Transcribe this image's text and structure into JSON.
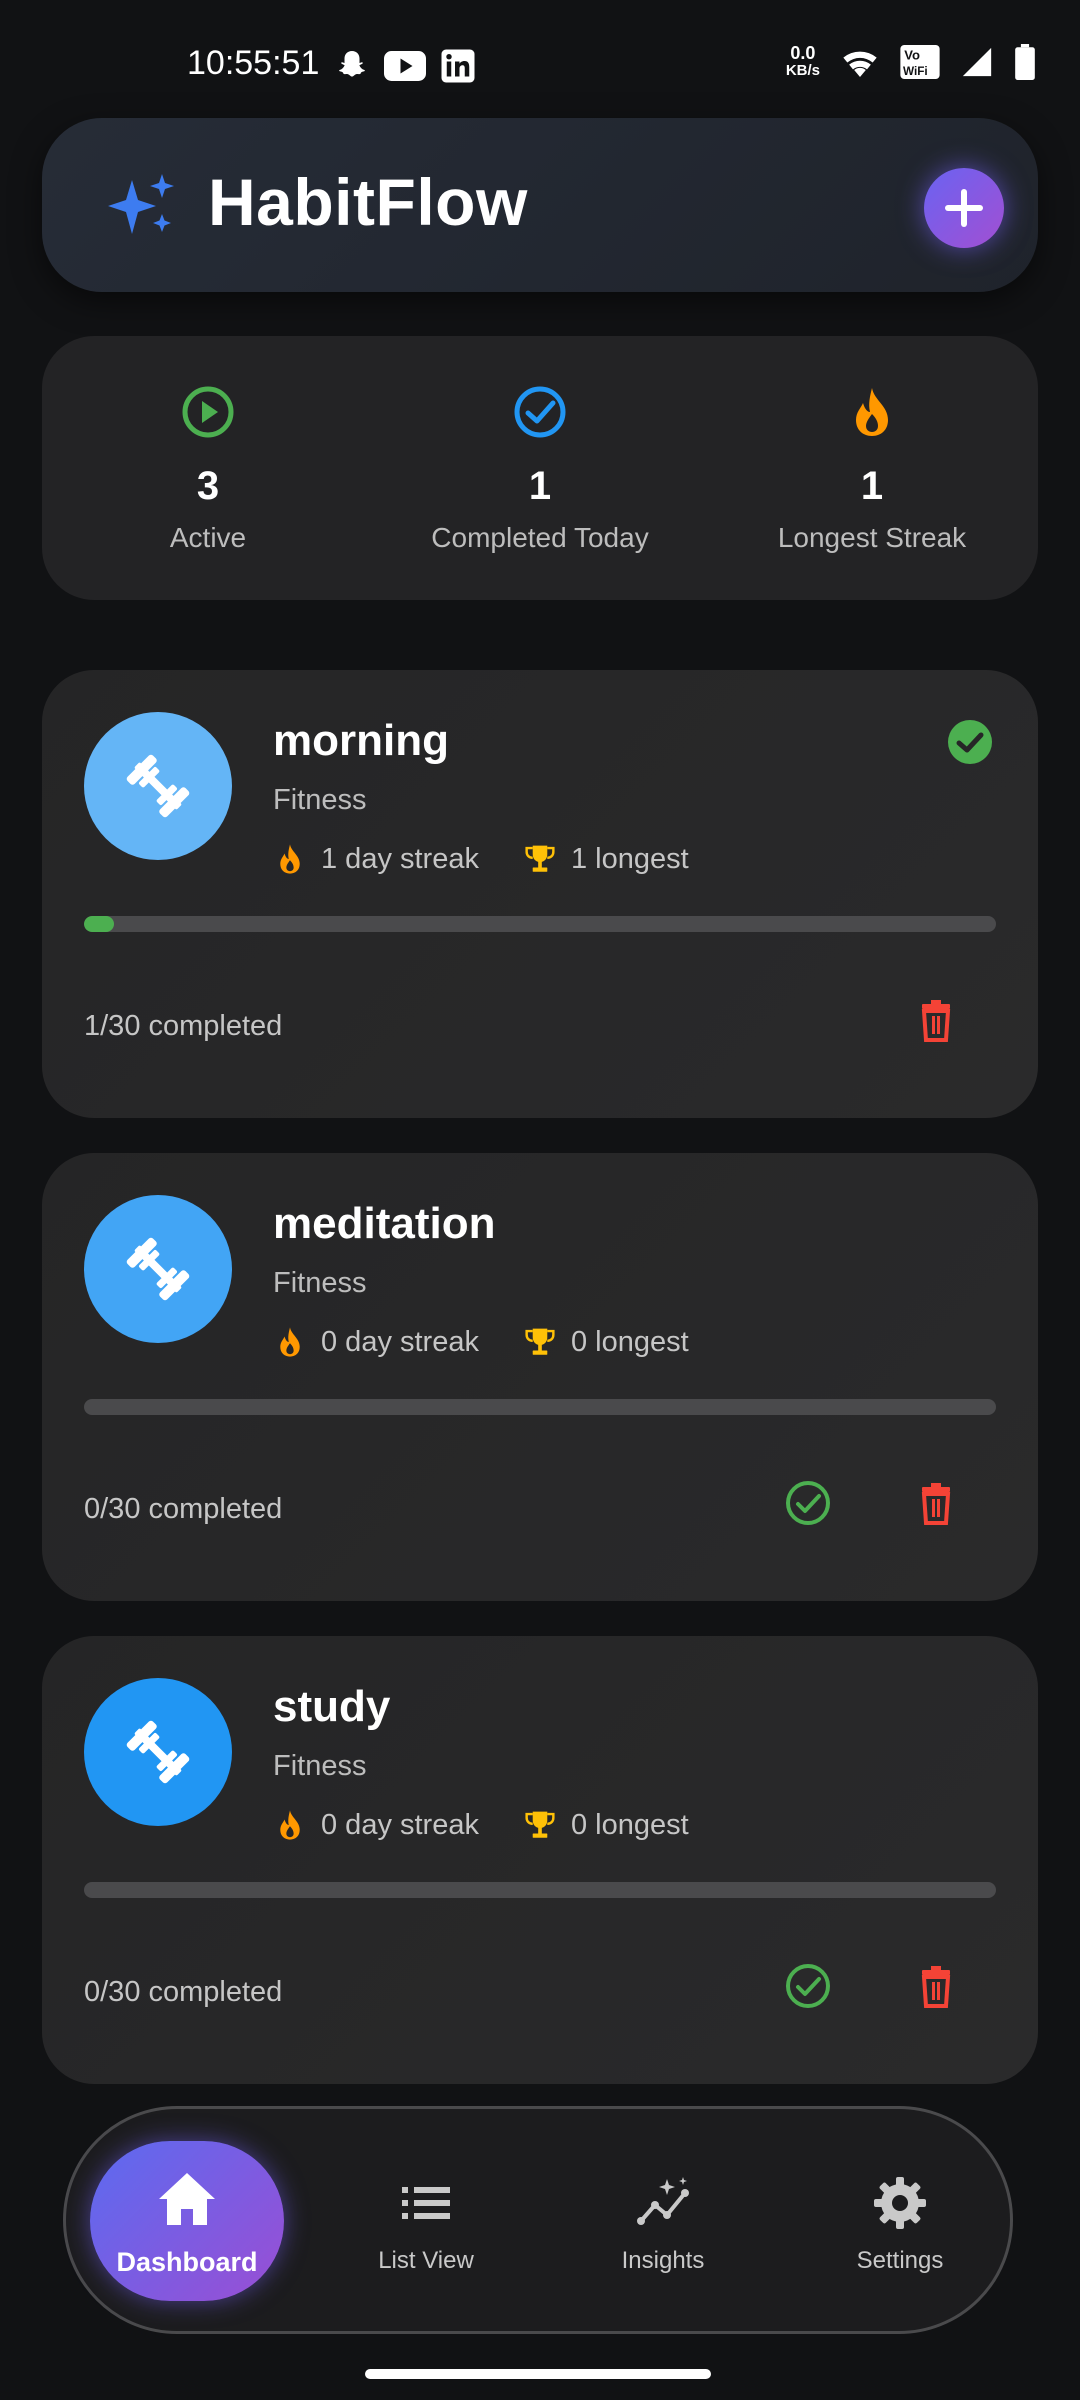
{
  "status_bar": {
    "time": "10:55:51",
    "net_speed_value": "0.0",
    "net_speed_unit": "KB/s",
    "icons": [
      "snapchat-icon",
      "youtube-icon",
      "linkedin-icon",
      "wifi-icon",
      "vowifi-icon",
      "signal-icon",
      "battery-icon"
    ]
  },
  "header": {
    "title": "HabitFlow",
    "logo_icon": "sparkles-icon",
    "add_icon": "plus-icon"
  },
  "stats": [
    {
      "icon": "play-circle-icon",
      "value": "3",
      "label": "Active",
      "color": "#4caf50"
    },
    {
      "icon": "check-circle-icon",
      "value": "1",
      "label": "Completed Today",
      "color": "#2196f3"
    },
    {
      "icon": "flame-icon",
      "value": "1",
      "label": "Longest Streak",
      "color": "#ff9800"
    }
  ],
  "habits": [
    {
      "name": "morning",
      "category": "Fitness",
      "streak": "1 day streak",
      "longest": "1 longest",
      "completed": "1/30 completed",
      "progress": 0.0333,
      "done_today": true,
      "avatar_color": "#64b5f6"
    },
    {
      "name": "meditation",
      "category": "Fitness",
      "streak": "0 day streak",
      "longest": "0 longest",
      "completed": "0/30 completed",
      "progress": 0,
      "done_today": false,
      "avatar_color": "#42a5f5"
    },
    {
      "name": "study",
      "category": "Fitness",
      "streak": "0 day streak",
      "longest": "0 longest",
      "completed": "0/30 completed",
      "progress": 0,
      "done_today": false,
      "avatar_color": "#2196f3"
    }
  ],
  "nav": {
    "items": [
      {
        "label": "Dashboard",
        "icon": "home-icon",
        "active": true
      },
      {
        "label": "List View",
        "icon": "list-icon",
        "active": false
      },
      {
        "label": "Insights",
        "icon": "insights-icon",
        "active": false
      },
      {
        "label": "Settings",
        "icon": "gear-icon",
        "active": false
      }
    ]
  },
  "colors": {
    "green": "#4caf50",
    "orange": "#ff9800",
    "gold": "#ffc107",
    "red": "#f44336",
    "blue": "#2196f3"
  }
}
